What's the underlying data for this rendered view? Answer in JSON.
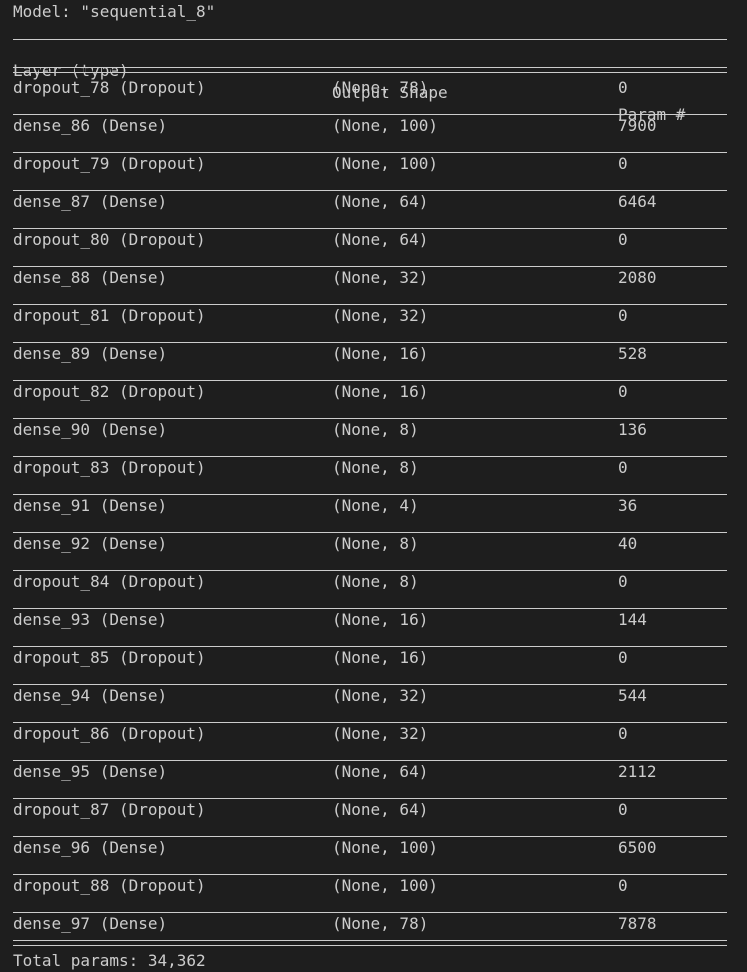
{
  "model": {
    "title": "Model: \"sequential_8\""
  },
  "header": {
    "layer": "Layer (type)",
    "output": "Output Shape",
    "params": "Param #"
  },
  "layers": [
    {
      "name": "dropout_78 (Dropout)",
      "shape": "(None, 78)",
      "params": "0"
    },
    {
      "name": "dense_86 (Dense)",
      "shape": "(None, 100)",
      "params": "7900"
    },
    {
      "name": "dropout_79 (Dropout)",
      "shape": "(None, 100)",
      "params": "0"
    },
    {
      "name": "dense_87 (Dense)",
      "shape": "(None, 64)",
      "params": "6464"
    },
    {
      "name": "dropout_80 (Dropout)",
      "shape": "(None, 64)",
      "params": "0"
    },
    {
      "name": "dense_88 (Dense)",
      "shape": "(None, 32)",
      "params": "2080"
    },
    {
      "name": "dropout_81 (Dropout)",
      "shape": "(None, 32)",
      "params": "0"
    },
    {
      "name": "dense_89 (Dense)",
      "shape": "(None, 16)",
      "params": "528"
    },
    {
      "name": "dropout_82 (Dropout)",
      "shape": "(None, 16)",
      "params": "0"
    },
    {
      "name": "dense_90 (Dense)",
      "shape": "(None, 8)",
      "params": "136"
    },
    {
      "name": "dropout_83 (Dropout)",
      "shape": "(None, 8)",
      "params": "0"
    },
    {
      "name": "dense_91 (Dense)",
      "shape": "(None, 4)",
      "params": "36"
    },
    {
      "name": "dense_92 (Dense)",
      "shape": "(None, 8)",
      "params": "40"
    },
    {
      "name": "dropout_84 (Dropout)",
      "shape": "(None, 8)",
      "params": "0"
    },
    {
      "name": "dense_93 (Dense)",
      "shape": "(None, 16)",
      "params": "144"
    },
    {
      "name": "dropout_85 (Dropout)",
      "shape": "(None, 16)",
      "params": "0"
    },
    {
      "name": "dense_94 (Dense)",
      "shape": "(None, 32)",
      "params": "544"
    },
    {
      "name": "dropout_86 (Dropout)",
      "shape": "(None, 32)",
      "params": "0"
    },
    {
      "name": "dense_95 (Dense)",
      "shape": "(None, 64)",
      "params": "2112"
    },
    {
      "name": "dropout_87 (Dropout)",
      "shape": "(None, 64)",
      "params": "0"
    },
    {
      "name": "dense_96 (Dense)",
      "shape": "(None, 100)",
      "params": "6500"
    },
    {
      "name": "dropout_88 (Dropout)",
      "shape": "(None, 100)",
      "params": "0"
    },
    {
      "name": "dense_97 (Dense)",
      "shape": "(None, 78)",
      "params": "7878"
    }
  ],
  "footer": {
    "total": "Total params: 34,362"
  },
  "colors": {
    "background": "#1e1e1e",
    "text": "#cccccc"
  }
}
